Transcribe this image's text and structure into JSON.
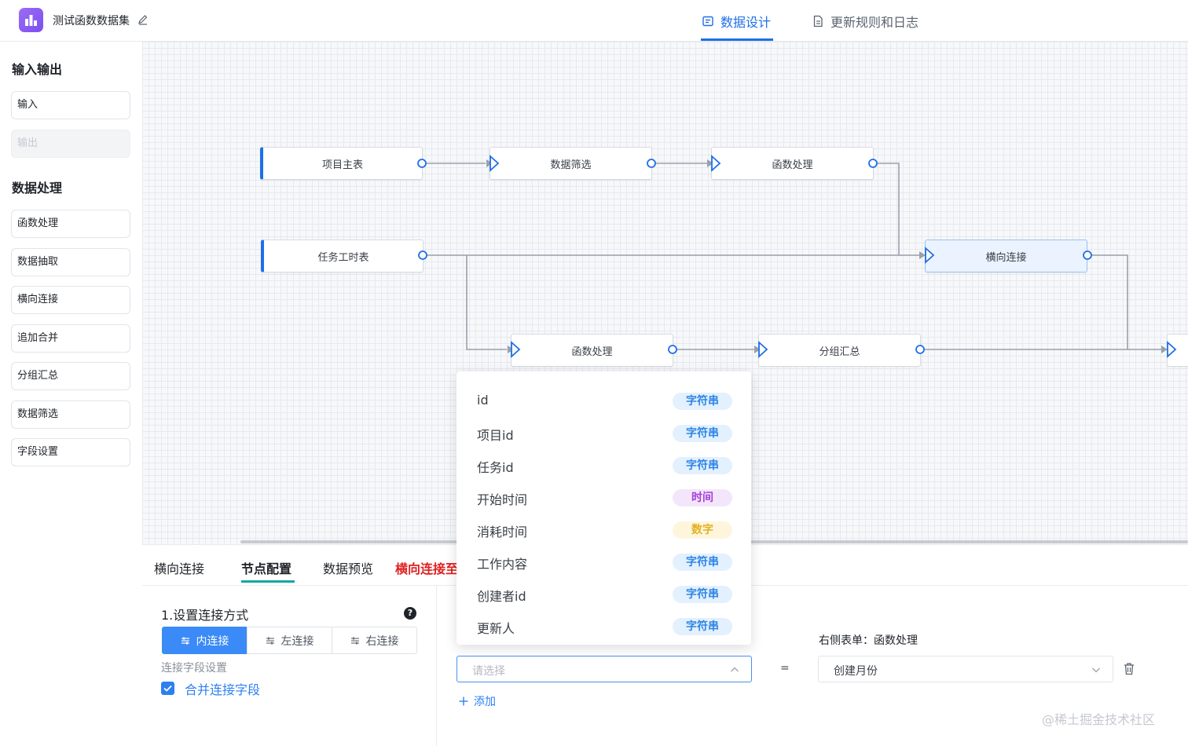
{
  "header": {
    "app_title": "测试函数数据集",
    "tabs": [
      {
        "label": "数据设计",
        "active": true
      },
      {
        "label": "更新规则和日志",
        "active": false
      }
    ]
  },
  "sidebar": {
    "io_title": "输入输出",
    "io_items": [
      {
        "label": "输入",
        "disabled": false
      },
      {
        "label": "输出",
        "disabled": true
      }
    ],
    "proc_title": "数据处理",
    "proc_items": [
      {
        "label": "函数处理"
      },
      {
        "label": "数据抽取"
      },
      {
        "label": "横向连接"
      },
      {
        "label": "追加合并"
      },
      {
        "label": "分组汇总"
      },
      {
        "label": "数据筛选"
      },
      {
        "label": "字段设置"
      }
    ]
  },
  "canvas": {
    "nodes": [
      {
        "id": "n1",
        "label": "项目主表",
        "kind": "source"
      },
      {
        "id": "n2",
        "label": "数据筛选",
        "kind": "process"
      },
      {
        "id": "n3",
        "label": "函数处理",
        "kind": "process"
      },
      {
        "id": "n4",
        "label": "任务工时表",
        "kind": "source"
      },
      {
        "id": "n5",
        "label": "横向连接",
        "kind": "process",
        "selected": true
      },
      {
        "id": "n6",
        "label": "函数处理",
        "kind": "process"
      },
      {
        "id": "n7",
        "label": "分组汇总",
        "kind": "process"
      }
    ]
  },
  "bottom": {
    "tabs": [
      {
        "label": "横向连接"
      },
      {
        "label": "节点配置",
        "active": true
      },
      {
        "label": "数据预览"
      },
      {
        "label": "横向连接至"
      }
    ],
    "section_title": "1.设置连接方式",
    "join_modes": [
      {
        "label": "内连接",
        "active": true
      },
      {
        "label": "左连接",
        "active": false
      },
      {
        "label": "右连接",
        "active": false
      }
    ],
    "field_setting_label": "连接字段设置",
    "merge_checkbox": {
      "label": "合并连接字段",
      "checked": true
    },
    "left_select_placeholder": "请选择",
    "equals": "=",
    "right_form_label": "右侧表单：函数处理",
    "right_select_value": "创建月份",
    "add_label": "添加",
    "dropdown_options": [
      {
        "name": "id",
        "type": "字符串",
        "kind": "str"
      },
      {
        "name": "项目id",
        "type": "字符串",
        "kind": "str"
      },
      {
        "name": "任务id",
        "type": "字符串",
        "kind": "str"
      },
      {
        "name": "开始时间",
        "type": "时间",
        "kind": "time"
      },
      {
        "name": "消耗时间",
        "type": "数字",
        "kind": "num"
      },
      {
        "name": "工作内容",
        "type": "字符串",
        "kind": "str"
      },
      {
        "name": "创建者id",
        "type": "字符串",
        "kind": "str"
      },
      {
        "name": "更新人",
        "type": "字符串",
        "kind": "str"
      }
    ]
  },
  "watermark": "@稀土掘金技术社区",
  "colors": {
    "accent": "#1e6fe8",
    "teal": "#15a8a0",
    "danger": "#e02020"
  }
}
